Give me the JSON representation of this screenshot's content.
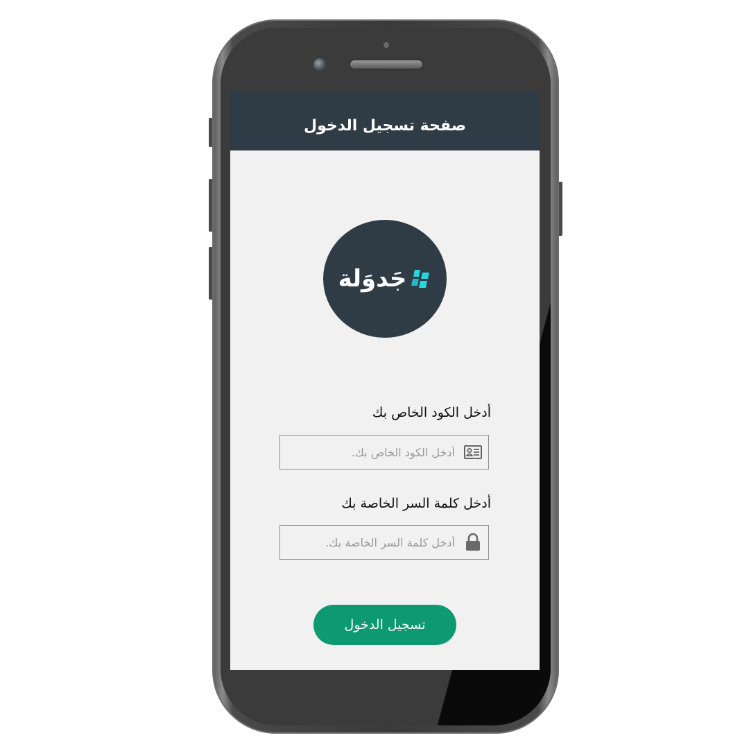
{
  "appbar": {
    "title": "صفحة تسجيل الدخول"
  },
  "logo": {
    "text": "جَدوَلة",
    "colors": {
      "circle": "#2f3b45",
      "mark_primary": "#25d6e0",
      "mark_secondary": "#1fb8c4"
    }
  },
  "form": {
    "code": {
      "label": "أدخل الكود الخاص بك",
      "placeholder": "أدخل الكود الخاص بك.",
      "value": "",
      "icon": "id-card-icon"
    },
    "password": {
      "label": "أدخل كلمة السر الخاصة بك",
      "placeholder": "أدخل كلمة السر الخاصة بك.",
      "value": "",
      "icon": "lock-icon"
    },
    "submit_label": "تسجيل الدخول"
  },
  "colors": {
    "appbar": "#2f3b45",
    "background": "#f1f1f1",
    "accent": "#0e9a70"
  }
}
